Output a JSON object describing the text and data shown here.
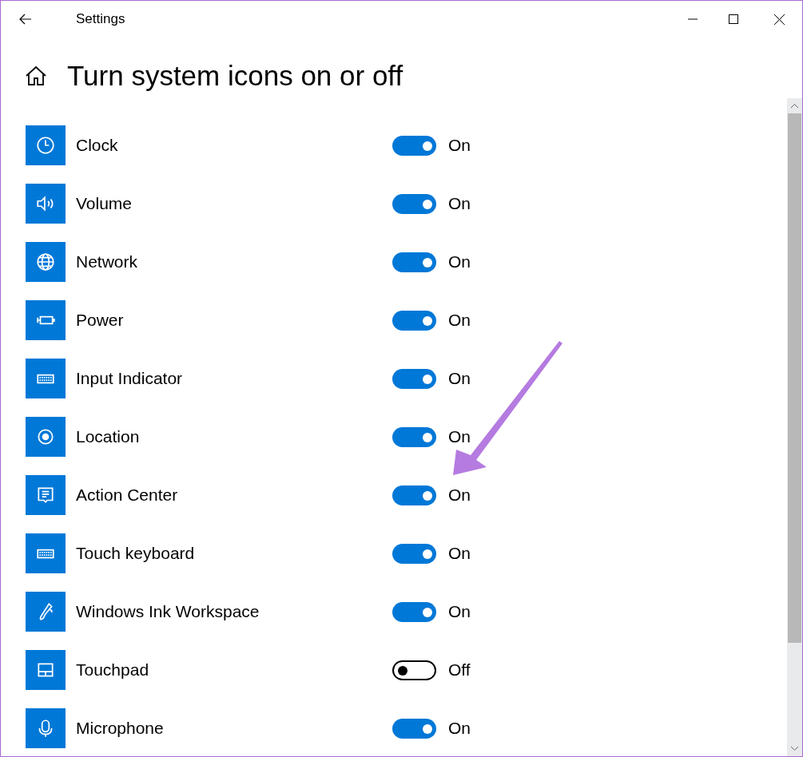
{
  "window": {
    "title": "Settings"
  },
  "page": {
    "heading": "Turn system icons on or off"
  },
  "items": [
    {
      "name": "Clock",
      "on": true,
      "state_label": "On"
    },
    {
      "name": "Volume",
      "on": true,
      "state_label": "On"
    },
    {
      "name": "Network",
      "on": true,
      "state_label": "On"
    },
    {
      "name": "Power",
      "on": true,
      "state_label": "On"
    },
    {
      "name": "Input Indicator",
      "on": true,
      "state_label": "On"
    },
    {
      "name": "Location",
      "on": true,
      "state_label": "On"
    },
    {
      "name": "Action Center",
      "on": true,
      "state_label": "On"
    },
    {
      "name": "Touch keyboard",
      "on": true,
      "state_label": "On"
    },
    {
      "name": "Windows Ink Workspace",
      "on": true,
      "state_label": "On"
    },
    {
      "name": "Touchpad",
      "on": false,
      "state_label": "Off"
    },
    {
      "name": "Microphone",
      "on": true,
      "state_label": "On"
    }
  ]
}
